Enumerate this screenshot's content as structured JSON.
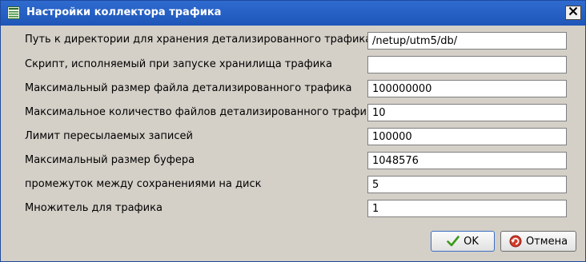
{
  "window": {
    "title": "Настройки коллектора трафика",
    "title_icon": "table-icon",
    "close_icon": "close-icon"
  },
  "fields": [
    {
      "label": "Путь к директории для хранения детализированного трафика",
      "value": "/netup/utm5/db/"
    },
    {
      "label": "Скрипт, исполняемый при запуске хранилища трафика",
      "value": ""
    },
    {
      "label": "Максимальный размер файла детализированного трафика",
      "value": "100000000"
    },
    {
      "label": "Максимальное количество файлов детализированного трафика",
      "value": "10"
    },
    {
      "label": "Лимит пересылаемых записей",
      "value": "100000"
    },
    {
      "label": "Максимальный размер буфера",
      "value": "1048576"
    },
    {
      "label": "промежуток между сохранениями на диск",
      "value": "5"
    },
    {
      "label": "Множитель для трафика",
      "value": "1"
    }
  ],
  "buttons": {
    "ok": {
      "label": "OK",
      "icon": "checkmark-icon",
      "icon_color": "#3a9a1a"
    },
    "cancel": {
      "label": "Отмена",
      "icon": "cancel-icon",
      "icon_color": "#c0392b"
    }
  },
  "colors": {
    "titlebar": "#2560c4",
    "dialog_bg": "#d4d0c8"
  }
}
